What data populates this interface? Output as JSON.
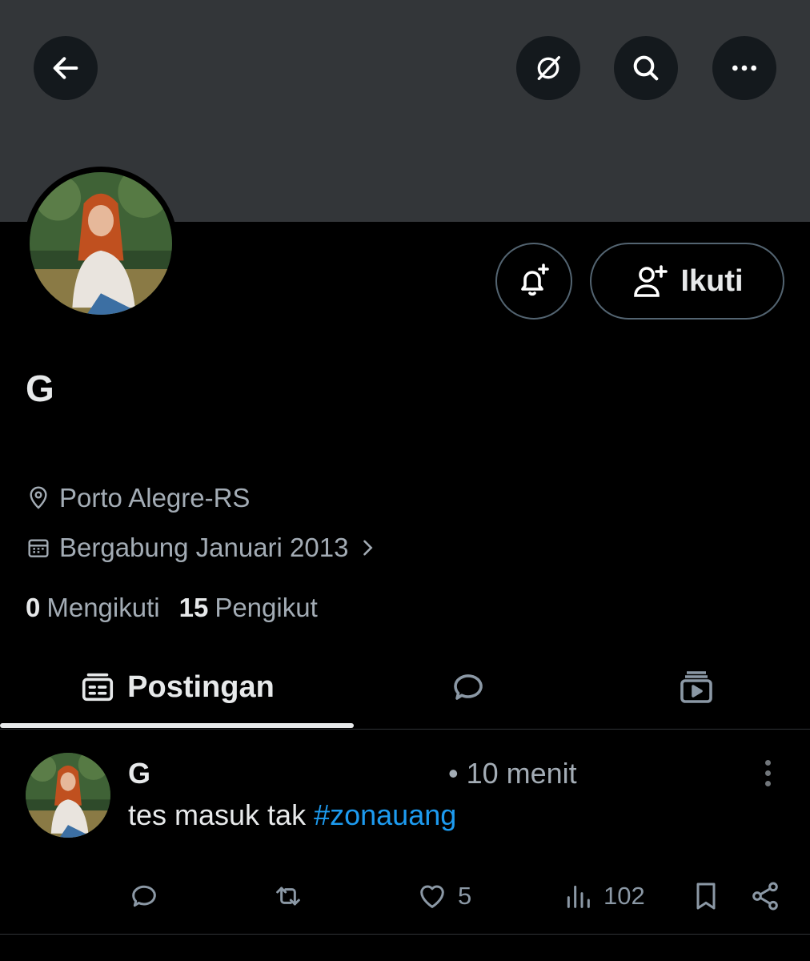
{
  "header": {
    "back_icon": "arrow-left-icon",
    "grok_icon": "grok-icon",
    "search_icon": "search-icon",
    "more_icon": "more-horizontal-icon",
    "banner_color": "#333639"
  },
  "profile": {
    "name": "G",
    "location": "Porto Alegre-RS",
    "joined": "Bergabung Januari 2013",
    "following_count": "0",
    "following_label": "Mengikuti",
    "followers_count": "15",
    "followers_label": "Pengikut",
    "follow_label": "Ikuti"
  },
  "tabs": {
    "posts_label": "Postingan",
    "active": "Postingan"
  },
  "post": {
    "author": "G",
    "time": "• 10 menit",
    "text": "tes masuk tak ",
    "hashtag": "#zonauang",
    "likes": "5",
    "views": "102"
  },
  "colors": {
    "accent": "#1d9bf0",
    "text_primary": "#e7e9ea",
    "text_secondary": "#71767b"
  }
}
